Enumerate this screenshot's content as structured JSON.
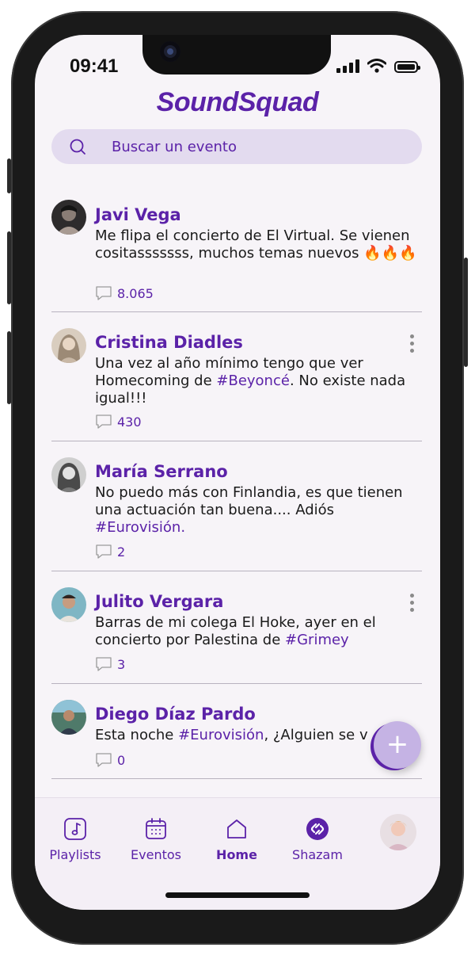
{
  "status_bar": {
    "time": "09:41"
  },
  "app": {
    "title": "SoundSquad",
    "accent": "#5b22a8"
  },
  "search": {
    "placeholder": "Buscar un evento",
    "icon": "search-icon"
  },
  "posts": [
    {
      "author": "Javi Vega",
      "text_parts": [
        "Me flipa el concierto de El Virtual. Se vienen cositasssssss, muchos temas nuevos 🔥🔥🔥"
      ],
      "comments": "8.065",
      "has_menu": false
    },
    {
      "author": "Cristina Diadles",
      "text_before": "Una vez al año mínimo tengo que ver Homecoming de ",
      "hashtag": "#Beyoncé",
      "text_after": ". No existe nada igual!!!",
      "comments": "430",
      "has_menu": true
    },
    {
      "author": "María Serrano",
      "text_before": "No puedo más con Finlandia, es que tienen una actuación tan buena.... Adiós ",
      "hashtag": "#Eurovisión.",
      "text_after": "",
      "comments": "2",
      "has_menu": false
    },
    {
      "author": "Julito Vergara",
      "text_before": "Barras de mi colega El Hoke, ayer en el concierto por Palestina de ",
      "hashtag": "#Grimey",
      "text_after": "",
      "comments": "3",
      "has_menu": true
    },
    {
      "author": "Diego Díaz Pardo",
      "text_before": "Esta noche ",
      "hashtag": "#Eurovisión",
      "text_after": ", ¿Alguien se v",
      "comments": "0",
      "has_menu": false
    }
  ],
  "fab": {
    "label": "+",
    "icon": "plus-icon"
  },
  "nav": {
    "items": [
      {
        "label": "Playlists",
        "icon": "music-note-icon"
      },
      {
        "label": "Eventos",
        "icon": "calendar-icon"
      },
      {
        "label": "Home",
        "icon": "home-icon",
        "active": true
      },
      {
        "label": "Shazam",
        "icon": "shazam-icon"
      }
    ],
    "profile_icon": "profile-avatar"
  }
}
